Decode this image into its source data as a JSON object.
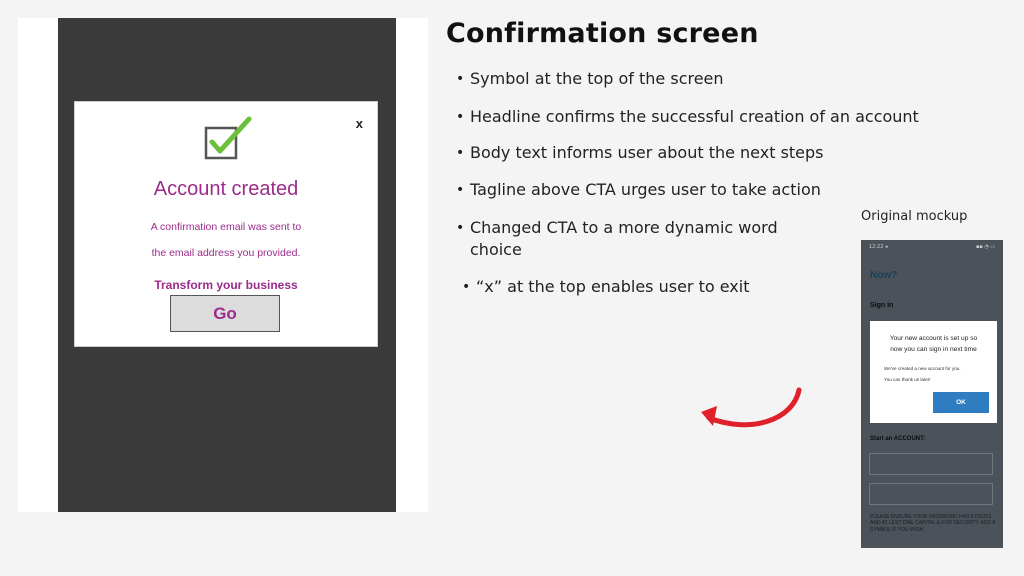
{
  "slide": {
    "heading": "Confirmation screen",
    "bullets": [
      "Symbol at the top of the screen",
      "Headline confirms the successful creation of an account",
      "Body text informs user about the next steps",
      "Tagline above CTA urges user to take action",
      "Changed CTA to a more dynamic word choice",
      "“x” at the top enables user to exit"
    ],
    "bullet_glyph": "•",
    "original_label": "Original mockup"
  },
  "redesign": {
    "close_label": "x",
    "title": "Account created",
    "body_line1": "A confirmation email was sent to",
    "body_line2": "the email address you provided.",
    "tagline": "Transform your business",
    "cta_label": "Go",
    "icon": "checkbox-check-icon"
  },
  "original": {
    "status_time": "12:22 ◂",
    "status_icons": "▪▪ ◔ ▭",
    "header": "Now?",
    "sign_in": "Sign in",
    "modal_title_line1": "Your new account is set up so",
    "modal_title_line2": "now you can sign in next time",
    "modal_body_line1": "We've created a new account for you.",
    "modal_body_line2": "You can thank us later!",
    "ok_label": "OK",
    "start_label": "Start an ACCOUNT:",
    "password_note": "PLEASE ENSURE YOUR PASSWORD HAS 8 DIGITS AND AT LEST ONE CAPITAL & FOR SECURITY, ADD A SYMBOL IF YOU WISH."
  },
  "colors": {
    "accent_purple": "#9b2c8a",
    "check_green": "#6cbf3a",
    "arrow_red": "#e0202a",
    "ok_blue": "#2f7dc0"
  }
}
